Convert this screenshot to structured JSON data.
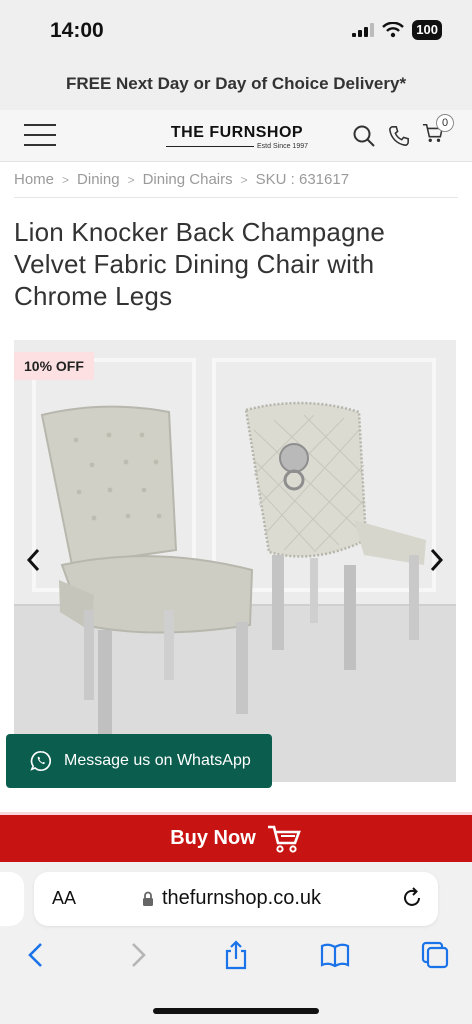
{
  "status": {
    "time": "14:00",
    "battery": "100"
  },
  "promo": {
    "text": "FREE Next Day or Day of Choice Delivery*"
  },
  "header": {
    "logo_name": "THE FURNSHOP",
    "logo_tagline": "Estd Since 1997",
    "cart_count": "0"
  },
  "breadcrumb": {
    "home": "Home",
    "dining": "Dining",
    "dining_chairs": "Dining Chairs",
    "sku": "SKU : 631617",
    "sep": ">"
  },
  "product": {
    "title": "Lion Knocker Back Champagne Velvet Fabric Dining Chair with Chrome Legs",
    "discount_badge": "10% OFF"
  },
  "whatsapp": {
    "label": "Message us on WhatsApp"
  },
  "buy": {
    "label": "Buy Now"
  },
  "browser": {
    "aa": "AA",
    "url": "thefurnshop.co.uk"
  },
  "colors": {
    "buy_red": "#c81313",
    "whatsapp_green": "#0b5d4e",
    "badge_pink": "#fde0e2",
    "safari_blue": "#1a73e8"
  }
}
